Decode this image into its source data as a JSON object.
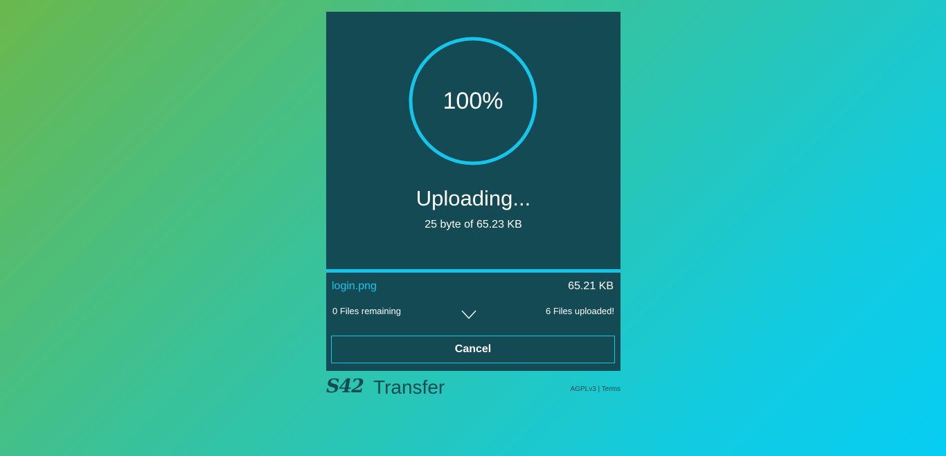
{
  "upload": {
    "percent_label": "100%",
    "progress": 1.0,
    "title": "Uploading...",
    "subtitle": "25 byte of 65.23 KB"
  },
  "current_file": {
    "name": "login.png",
    "size": "65.21 KB"
  },
  "stats": {
    "remaining": "0 Files remaining",
    "uploaded": "6 Files uploaded!"
  },
  "actions": {
    "cancel_label": "Cancel",
    "expand_icon": "chevron-down-icon"
  },
  "footer": {
    "logo_mark": "S42",
    "logo_text": "Transfer",
    "license_link": "AGPLv3",
    "separator": "|",
    "terms_link": "Terms"
  },
  "colors": {
    "card_background": "#134a54",
    "accent": "#15c6ea",
    "text": "#ffffff"
  }
}
